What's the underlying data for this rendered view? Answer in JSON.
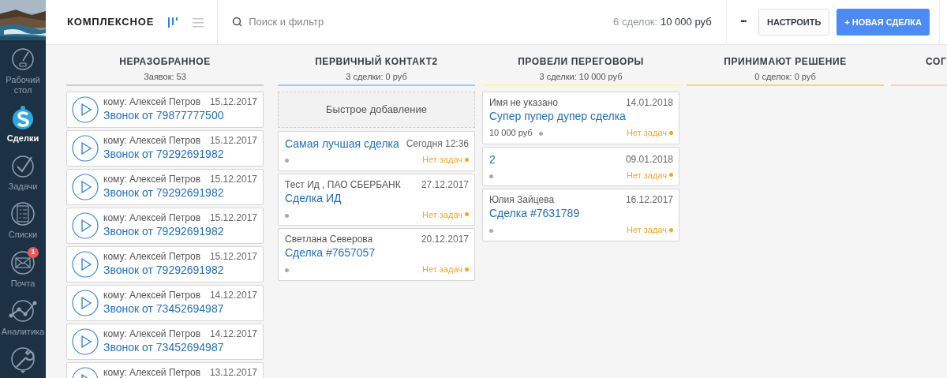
{
  "sidebar": {
    "items": [
      {
        "label": "Рабочий стол",
        "kind": "dashboard",
        "selected": false
      },
      {
        "label": "Сделки",
        "kind": "deals",
        "selected": true
      },
      {
        "label": "Задачи",
        "kind": "tasks",
        "selected": false
      },
      {
        "label": "Списки",
        "kind": "lists",
        "selected": false
      },
      {
        "label": "Почта",
        "kind": "mail",
        "selected": false,
        "badge": "1"
      },
      {
        "label": "Аналитика",
        "kind": "analytics",
        "selected": false
      },
      {
        "kind": "tools",
        "selected": false
      }
    ]
  },
  "toolbar": {
    "title": "КОМПЛЕКСНОЕ",
    "views": [
      {
        "kind": "pipeline",
        "selected": true
      },
      {
        "kind": "list",
        "selected": false
      }
    ],
    "search": {
      "placeholder": "Поиск и фильтр"
    },
    "summary_count": "6 сделок:",
    "summary_sum": "10 000 руб",
    "more": "•••",
    "buttons": [
      {
        "label": "НАСТРОИТЬ",
        "kind": "secondary"
      },
      {
        "label": "+ НОВАЯ СДЕЛКА",
        "kind": "primary"
      }
    ]
  },
  "columns": [
    {
      "title": "НЕРАЗОБРАННОЕ",
      "subtitle": "Заявок: 53",
      "color": "#cccccc",
      "cards": [
        {
          "kind": "call",
          "to": "кому: Алексей Петров",
          "date": "15.12.2017",
          "name": "Звонок от 79877777500"
        },
        {
          "kind": "call",
          "to": "кому: Алексей Петров",
          "date": "15.12.2017",
          "name": "Звонок от 79292691982"
        },
        {
          "kind": "call",
          "to": "кому: Алексей Петров",
          "date": "15.12.2017",
          "name": "Звонок от 79292691982"
        },
        {
          "kind": "call",
          "to": "кому: Алексей Петров",
          "date": "15.12.2017",
          "name": "Звонок от 79292691982"
        },
        {
          "kind": "call",
          "to": "кому: Алексей Петров",
          "date": "15.12.2017",
          "name": "Звонок от 79292691982"
        },
        {
          "kind": "call",
          "to": "кому: Алексей Петров",
          "date": "14.12.2017",
          "name": "Звонок от 73452694987"
        },
        {
          "kind": "call",
          "to": "кому: Алексей Петров",
          "date": "14.12.2017",
          "name": "Звонок от 73452694987"
        },
        {
          "kind": "call",
          "to": "кому: Алексей Петров",
          "date": "13.12.2017"
        }
      ]
    },
    {
      "title": "ПЕРВИЧНЫЙ КОНТАКТ2",
      "subtitle": "3 сделки: 0 руб",
      "color": "#99ccff",
      "cards": [
        {
          "kind": "quick_add",
          "label": "Быстрое добавление"
        },
        {
          "kind": "deal",
          "name": "Самая лучшая сделка",
          "date": "Сегодня 12:36",
          "tasks": "Нет задач"
        },
        {
          "kind": "deal",
          "contact": "Тест Ид , ПАО СБЕРБАНК",
          "date": "27.12.2017",
          "name": "Сделка ИД",
          "tasks": "Нет задач"
        },
        {
          "kind": "deal",
          "contact": "Светлана Северова",
          "date": "20.12.2017",
          "name": "Сделка #7657057",
          "tasks": "Нет задач"
        }
      ]
    },
    {
      "title": "ПРОВЕЛИ ПЕРЕГОВОРЫ",
      "subtitle": "3 сделки: 10 000 руб",
      "color": "#fffd7f",
      "cards": [
        {
          "kind": "deal",
          "contact": "Имя не указано",
          "date": "14.01.2018",
          "name": "Супер пупер дупер сделка",
          "price": "10 000 руб",
          "tasks": "Нет задач"
        },
        {
          "kind": "deal",
          "name": "2",
          "date": "09.01.2018",
          "tasks": "Нет задач"
        },
        {
          "kind": "deal",
          "contact": "Юлия Зайцева",
          "date": "16.12.2017",
          "name": "Сделка #7631789",
          "tasks": "Нет задач"
        }
      ]
    },
    {
      "title": "ПРИНИМАЮТ РЕШЕНИЕ",
      "subtitle": "0 сделок: 0 руб",
      "color": "#fcd27c"
    },
    {
      "title": "СОГ",
      "color": "#ffcccc"
    }
  ]
}
